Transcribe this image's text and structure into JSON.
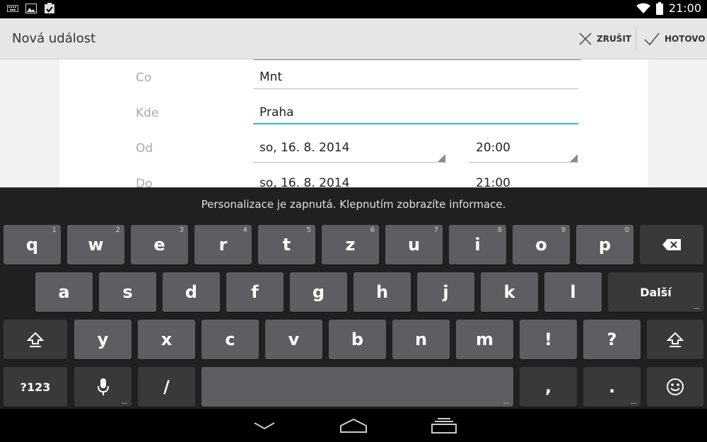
{
  "status_bar": {
    "time": "21:00",
    "icons": [
      "keyboard-icon",
      "image-icon",
      "clipboard-check-icon",
      "wifi-icon",
      "battery-icon"
    ]
  },
  "action_bar": {
    "title": "Nová událost",
    "cancel_label": "ZRUŠIT",
    "done_label": "HOTOVO"
  },
  "form": {
    "what_label": "Co",
    "what_value": "Mnt",
    "where_label": "Kde",
    "where_value": "Praha",
    "from_label": "Od",
    "from_date": "so, 16. 8. 2014",
    "from_time": "20:00",
    "to_label": "Do",
    "to_date": "so, 16. 8. 2014",
    "to_time": "21:00"
  },
  "keyboard": {
    "suggestion": "Personalizace je zapnutá. Klepnutím zobrazíte informace.",
    "row1": [
      {
        "label": "q",
        "hint": "1"
      },
      {
        "label": "w",
        "hint": "2"
      },
      {
        "label": "e",
        "hint": "3"
      },
      {
        "label": "r",
        "hint": "4"
      },
      {
        "label": "t",
        "hint": "5"
      },
      {
        "label": "z",
        "hint": "6"
      },
      {
        "label": "u",
        "hint": "7"
      },
      {
        "label": "i",
        "hint": "8"
      },
      {
        "label": "o",
        "hint": "9"
      },
      {
        "label": "p",
        "hint": "0"
      }
    ],
    "row2": [
      "a",
      "s",
      "d",
      "f",
      "g",
      "h",
      "j",
      "k",
      "l"
    ],
    "next_label": "Další",
    "row3": [
      "y",
      "x",
      "c",
      "v",
      "b",
      "n",
      "m",
      "!",
      "?"
    ],
    "symbols_label": "?123",
    "slash": "/",
    "comma": ",",
    "period": "."
  },
  "colors": {
    "accent": "#33b5e5",
    "key": "#5c5e61",
    "key_dark": "#38393b",
    "keyboard_bg": "#1f2022"
  }
}
